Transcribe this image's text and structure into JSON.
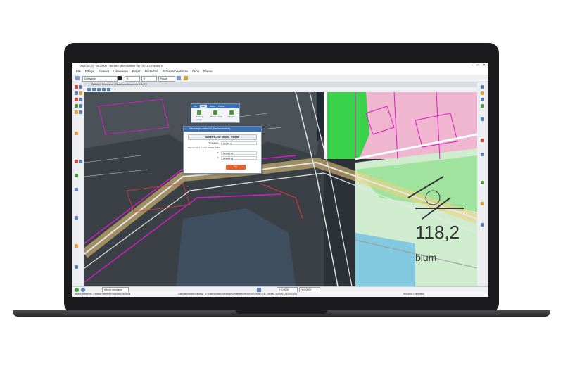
{
  "window": {
    "title": "DWG.rd (2) · 0E/2000 · Bentley MicroStation V8i (SELECTseries 4)"
  },
  "menu": {
    "items": [
      "Plik",
      "Edycja",
      "Element",
      "Ustawienia",
      "Pokaz",
      "Narzedzia",
      "Przestrzen robocza",
      "Okno",
      "Pomoc"
    ]
  },
  "toolbar": {
    "level_combo": "Domyslne",
    "style_combo": "0",
    "weight_combo": "0",
    "scale_combo": "Pauta"
  },
  "viewbar": {
    "title": "Widok 1, Domyslne - Skala powiekszenia: 1:1470"
  },
  "ribbon": {
    "tabs": [
      "Plik",
      "Start",
      "Widok",
      "Pomoc"
    ],
    "active_tab": "Start",
    "buttons": [
      "Zaladuj mapy",
      "Przesuwanie",
      "Ukrycie"
    ]
  },
  "dialog": {
    "title": "Informacje o obiekcie [GeoInformation]",
    "subtitle": "NUMERYCZNY MODEL TERENU",
    "rows": [
      {
        "label": "Wysokosc:",
        "value": "112.25 m"
      },
      {
        "label": "Wspolrzedne punktu PUWG 1992:",
        "value": ""
      },
      {
        "label": "X:",
        "value": "501919.29"
      },
      {
        "label": "Y:",
        "value": "564928.13"
      }
    ],
    "ok_label": "Ok"
  },
  "map": {
    "label_number": "118,2",
    "label_text": "blum"
  },
  "status": {
    "view_label": "Widok domyslne",
    "coord_field": "X 0.0000",
    "coord_field2": "Y 0.0000",
    "message": "Wybor elementu > Wskaz element docelowy do akcji",
    "file": "Zaloguj sie: Domyslna",
    "ref": "Zaktualizowano katalogi: [C:\\Users\\stolec\\Desktop\\Geostreets\\RNet\\2023\\NMT-031_06000_301000_363000.j2k]",
    "workspace": "Wspolna Domyslna"
  },
  "colors": {
    "accent": "#3b6fb6",
    "ok_button": "#e2622c",
    "map_bg": "#2b3136",
    "map_green": "#39d24a",
    "map_pink": "#f0b6cf",
    "map_magenta": "#d61cc7"
  }
}
